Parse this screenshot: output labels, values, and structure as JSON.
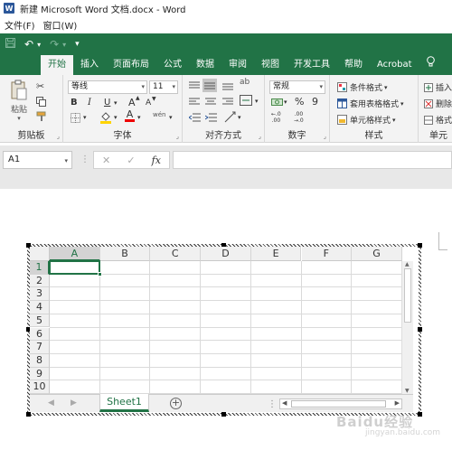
{
  "window": {
    "title": "新建 Microsoft Word 文档.docx - Word",
    "app_logo": "W"
  },
  "menu": {
    "items": [
      "文件(F)",
      "窗口(W)"
    ]
  },
  "qat": {
    "save_icon": "save-icon",
    "undo_icon": "↶",
    "redo_icon": "↷",
    "customize_icon": "▾"
  },
  "ribbon_tabs": [
    "开始",
    "插入",
    "页面布局",
    "公式",
    "数据",
    "审阅",
    "视图",
    "开发工具",
    "帮助",
    "Acrobat"
  ],
  "ribbon_active_tab": "开始",
  "ribbon": {
    "clipboard": {
      "label": "剪贴板",
      "paste": "粘贴"
    },
    "font": {
      "label": "字体",
      "font_name": "等线",
      "font_size": "11",
      "bold": "B",
      "italic": "I",
      "underline": "U",
      "grow": "A",
      "shrink": "A",
      "font_color": "A",
      "phonetic": "wén"
    },
    "alignment": {
      "label": "对齐方式",
      "wrap": "ab"
    },
    "number": {
      "label": "数字",
      "format": "常规",
      "percent": "%",
      "comma": "9",
      "inc_dec": ".0 .00",
      "currency": "¥"
    },
    "styles": {
      "label": "样式",
      "conditional": "条件格式",
      "table": "套用表格格式",
      "cell": "单元格样式"
    },
    "cells": {
      "label": "单元",
      "insert": "插入",
      "delete": "删除",
      "format": "格式"
    }
  },
  "formula_bar": {
    "name_box": "A1",
    "cancel": "✕",
    "enter": "✓",
    "fx": "fx",
    "value": ""
  },
  "sheet": {
    "columns": [
      "A",
      "B",
      "C",
      "D",
      "E",
      "F",
      "G"
    ],
    "rows": [
      "1",
      "2",
      "3",
      "4",
      "5",
      "6",
      "7",
      "8",
      "9",
      "10"
    ],
    "active_col": 0,
    "active_row": 0,
    "tab": "Sheet1",
    "add_sheet": "+"
  },
  "watermark": {
    "text": "Baidu经验",
    "sub": "jingyan.baidu.com"
  },
  "colors": {
    "accent": "#217346",
    "ribbon_bg": "#f3f3f3",
    "word_blue": "#2b579a"
  }
}
